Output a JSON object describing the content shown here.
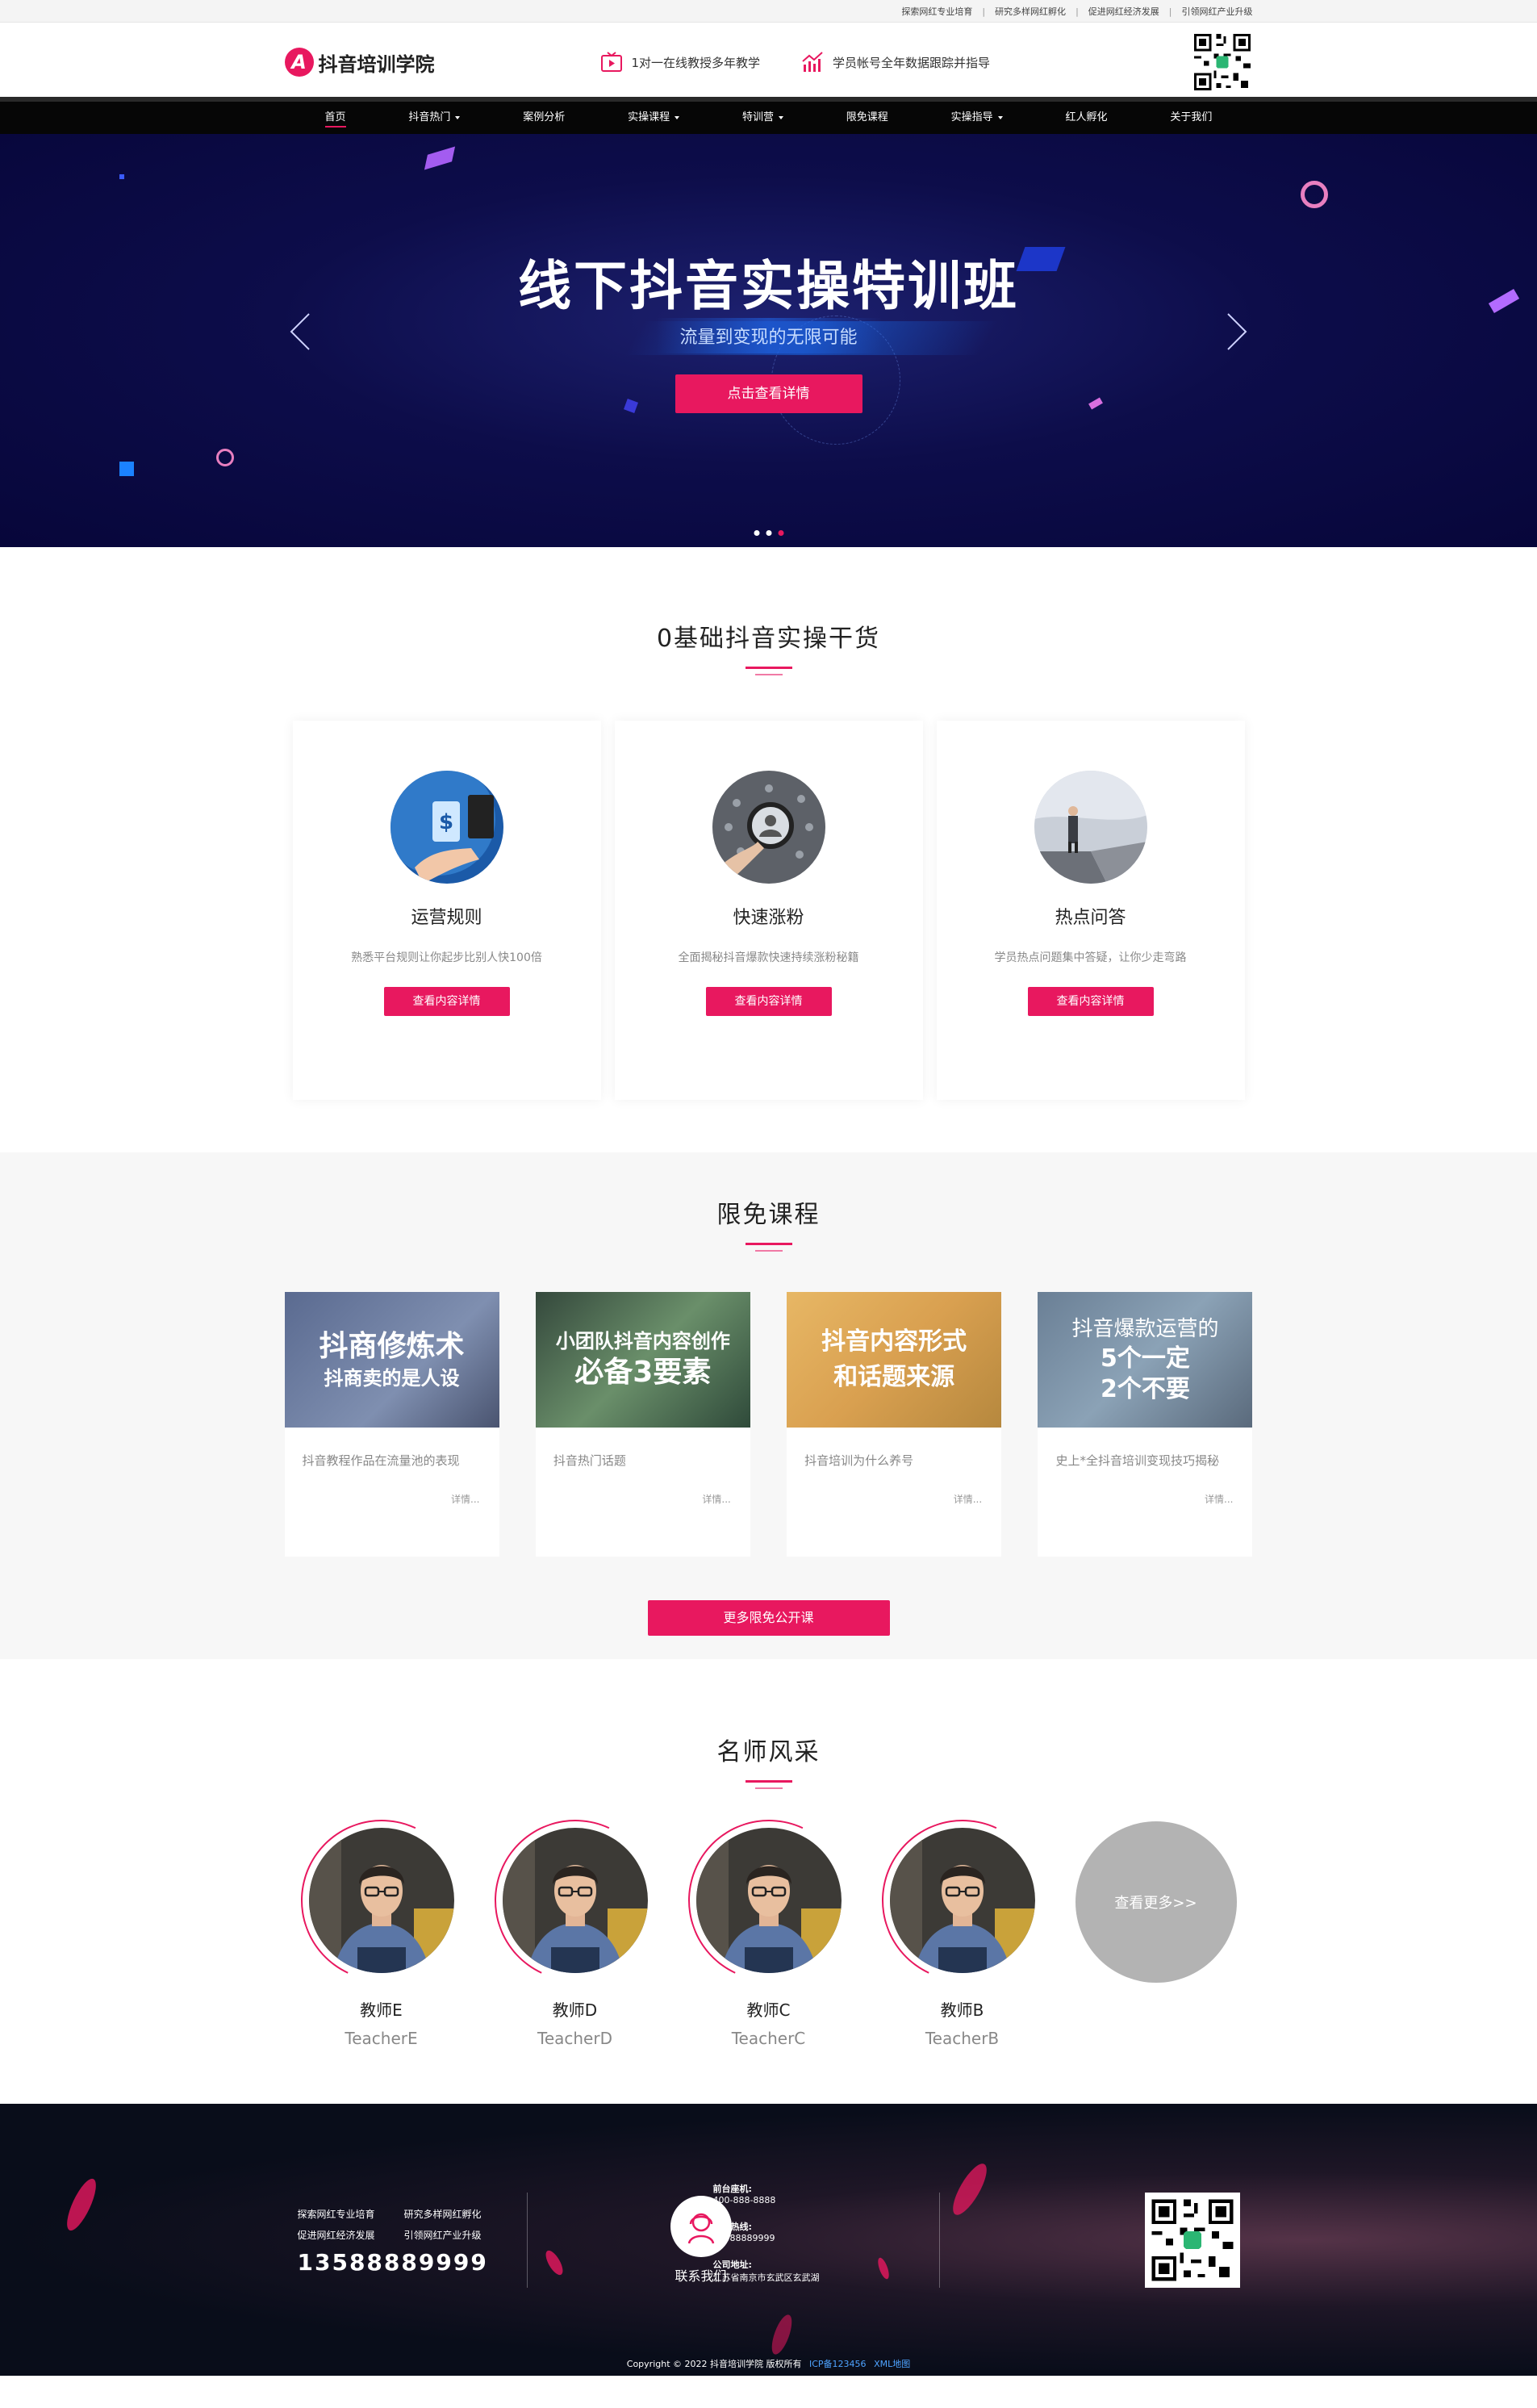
{
  "topbar": {
    "links": [
      "探索网红专业培育",
      "研究多样网红孵化",
      "促进网红经济发展",
      "引领网红产业升级"
    ],
    "separator": "|"
  },
  "header": {
    "logo_mark": "A",
    "logo_text": "抖音培训学院",
    "features": [
      {
        "icon": "tv-icon",
        "text": "1对一在线教授多年教学"
      },
      {
        "icon": "chart-icon",
        "text": "学员帐号全年数据跟踪并指导"
      }
    ],
    "qr_icon": "qr-code"
  },
  "nav": {
    "items": [
      {
        "label": "首页",
        "dropdown": false,
        "active": true
      },
      {
        "label": "抖音热门",
        "dropdown": true,
        "active": false
      },
      {
        "label": "案例分析",
        "dropdown": false,
        "active": false
      },
      {
        "label": "实操课程",
        "dropdown": true,
        "active": false
      },
      {
        "label": "特训营",
        "dropdown": true,
        "active": false
      },
      {
        "label": "限免课程",
        "dropdown": false,
        "active": false
      },
      {
        "label": "实操指导",
        "dropdown": true,
        "active": false
      },
      {
        "label": "红人孵化",
        "dropdown": false,
        "active": false
      },
      {
        "label": "关于我们",
        "dropdown": false,
        "active": false
      }
    ]
  },
  "banner": {
    "title": "线下抖音实操特训班",
    "subtitle": "流量到变现的无限可能",
    "button": "点击查看详情",
    "slides": 3,
    "active_slide": 3
  },
  "dry_goods": {
    "title": "0基础抖音实操干货",
    "cards": [
      {
        "title": "运营规则",
        "desc": "熟悉平台规则让你起步比别人快100倍",
        "button": "查看内容详情"
      },
      {
        "title": "快速涨粉",
        "desc": "全面揭秘抖音爆款快速持续涨粉秘籍",
        "button": "查看内容详情"
      },
      {
        "title": "热点问答",
        "desc": "学员热点问题集中答疑，让你少走弯路",
        "button": "查看内容详情"
      }
    ]
  },
  "free_courses": {
    "title": "限免课程",
    "courses": [
      {
        "cover_line1": "抖商修炼术",
        "cover_line2": "抖商卖的是人设",
        "desc": "抖音教程作品在流量池的表现",
        "more": "详情..."
      },
      {
        "cover_line1": "小团队抖音内容创作",
        "cover_line2": "必备3要素",
        "desc": "抖音热门话题",
        "more": "详情..."
      },
      {
        "cover_line1": "抖音内容形式",
        "cover_line2": "和话题来源",
        "desc": "抖音培训为什么养号",
        "more": "详情..."
      },
      {
        "cover_line1": "抖音爆款运营的",
        "cover_line2": "5个一定",
        "cover_line3": "2个不要",
        "desc": "史上*全抖音培训变现技巧揭秘",
        "more": "详情..."
      }
    ],
    "more_button": "更多限免公开课"
  },
  "teachers": {
    "title": "名师风采",
    "list": [
      {
        "name": "教师E",
        "en": "TeacherE"
      },
      {
        "name": "教师D",
        "en": "TeacherD"
      },
      {
        "name": "教师C",
        "en": "TeacherC"
      },
      {
        "name": "教师B",
        "en": "TeacherB"
      }
    ],
    "see_more": "查看更多>>"
  },
  "footer": {
    "links": [
      "探索网红专业培育",
      "研究多样网红孵化",
      "促进网红经济发展",
      "引领网红产业升级"
    ],
    "phone_big": "13588889999",
    "contact_label": "联系我们",
    "front_desk_label": "前台座机:",
    "front_desk": "400-888-8888",
    "hotline_label": "招生热线:",
    "hotline": "13588889999",
    "address_label": "公司地址:",
    "address": "江苏省南京市玄武区玄武湖",
    "copyright": "Copyright © 2022 抖音培训学院 版权所有",
    "icp": "ICP备123456",
    "sitemap": "XML地图"
  },
  "colors": {
    "accent": "#e8185f",
    "nav_bg": "#060606",
    "banner_bg": "#0d0d4a",
    "footer_bg": "#090d1a"
  }
}
